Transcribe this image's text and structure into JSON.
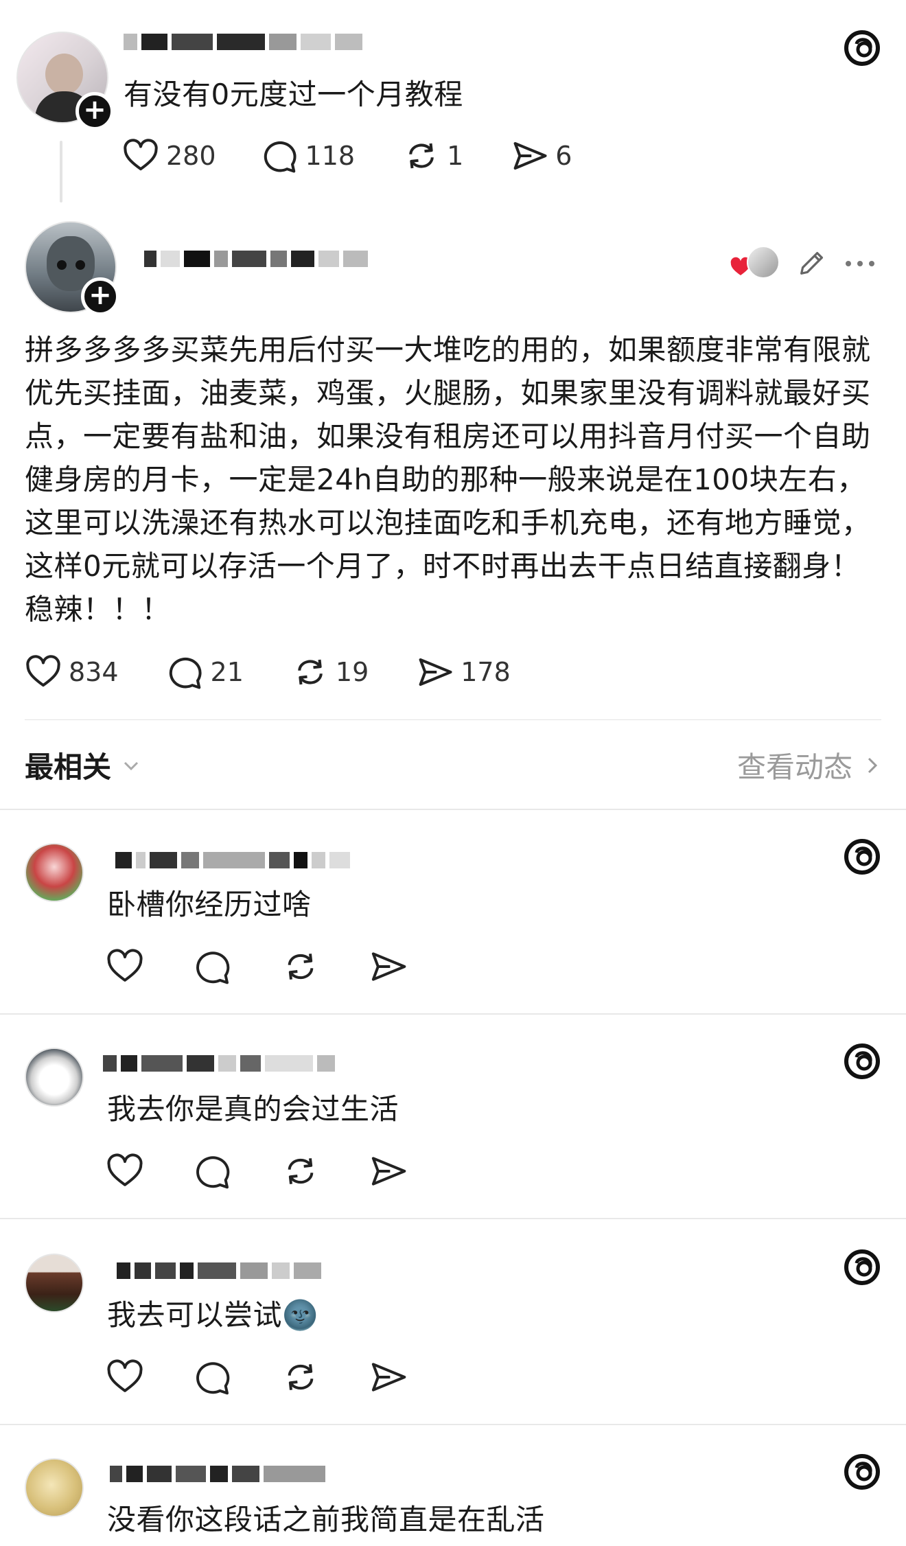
{
  "original_post": {
    "text": "有没有0元度过一个月教程",
    "likes": "280",
    "comments": "118",
    "reposts": "1",
    "shares": "6"
  },
  "reply_post": {
    "text": "拼多多多多买菜先用后付买一大堆吃的用的，如果额度非常有限就优先买挂面，油麦菜，鸡蛋，火腿肠，如果家里没有调料就最好买点，一定要有盐和油，如果没有租房还可以用抖音月付买一个自助健身房的月卡，一定是24h自助的那种一般来说是在100块左右，这里可以洗澡还有热水可以泡挂面吃和手机充电，还有地方睡觉，这样0元就可以存活一个月了，时不时再出去干点日结直接翻身！稳辣！！！",
    "likes": "834",
    "comments": "21",
    "reposts": "19",
    "shares": "178"
  },
  "sort_bar": {
    "sort_label": "最相关",
    "activity_link": "查看动态"
  },
  "comments": [
    {
      "text": "卧槽你经历过啥"
    },
    {
      "text": "我去你是真的会过生活"
    },
    {
      "text": "我去可以尝试🌚"
    },
    {
      "text": "没看你这段话之前我简直是在乱活"
    }
  ],
  "colors": {
    "accent_heart": "#e8233a",
    "icon": "#222222",
    "muted": "#9a9a9a"
  }
}
